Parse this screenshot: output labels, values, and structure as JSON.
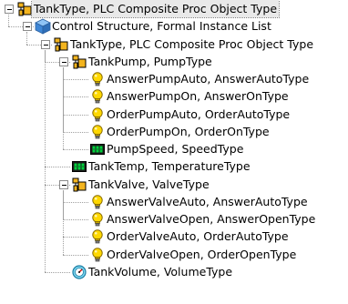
{
  "tree": {
    "nodes": [
      {
        "label": "TankType, PLC Composite Proc Object Type",
        "icon": "composite-object-type-icon",
        "level": 0,
        "expanded": true,
        "selected": true
      },
      {
        "label": "Control Structure, Formal Instance List",
        "icon": "structure-cube-icon",
        "level": 1,
        "expanded": true
      },
      {
        "label": "TankType, PLC Composite Proc Object Type",
        "icon": "composite-object-type-icon",
        "level": 2,
        "expanded": true
      },
      {
        "label": "TankPump, PumpType",
        "icon": "composite-object-type-icon",
        "level": 3,
        "expanded": true
      },
      {
        "label": "AnswerPumpAuto, AnswerAutoType",
        "icon": "bulb-icon",
        "level": 4
      },
      {
        "label": "AnswerPumpOn, AnswerOnType",
        "icon": "bulb-icon",
        "level": 4
      },
      {
        "label": "OrderPumpAuto, OrderAutoType",
        "icon": "bulb-icon",
        "level": 4
      },
      {
        "label": "OrderPumpOn, OrderOnType",
        "icon": "bulb-icon",
        "level": 4
      },
      {
        "label": "PumpSpeed, SpeedType",
        "icon": "digital-display-icon",
        "level": 4
      },
      {
        "label": "TankTemp, TemperatureType",
        "icon": "digital-display-icon",
        "level": 3
      },
      {
        "label": "TankValve, ValveType",
        "icon": "composite-object-type-icon",
        "level": 3,
        "expanded": true
      },
      {
        "label": "AnswerValveAuto, AnswerAutoType",
        "icon": "bulb-icon",
        "level": 4
      },
      {
        "label": "AnswerValveOpen, AnswerOpenType",
        "icon": "bulb-icon",
        "level": 4
      },
      {
        "label": "OrderValveAuto, OrderAutoType",
        "icon": "bulb-icon",
        "level": 4
      },
      {
        "label": "OrderValveOpen, OrderOpenType",
        "icon": "bulb-icon",
        "level": 4
      },
      {
        "label": "TankVolume, VolumeType",
        "icon": "gauge-icon",
        "level": 3
      }
    ]
  },
  "colors": {
    "bulb_yellow": "#ffd800",
    "folder_orange": "#f3b41e",
    "cube_blue": "#3f87d6",
    "display_green": "#00d23c",
    "selection_bg": "#e9e9e9"
  }
}
